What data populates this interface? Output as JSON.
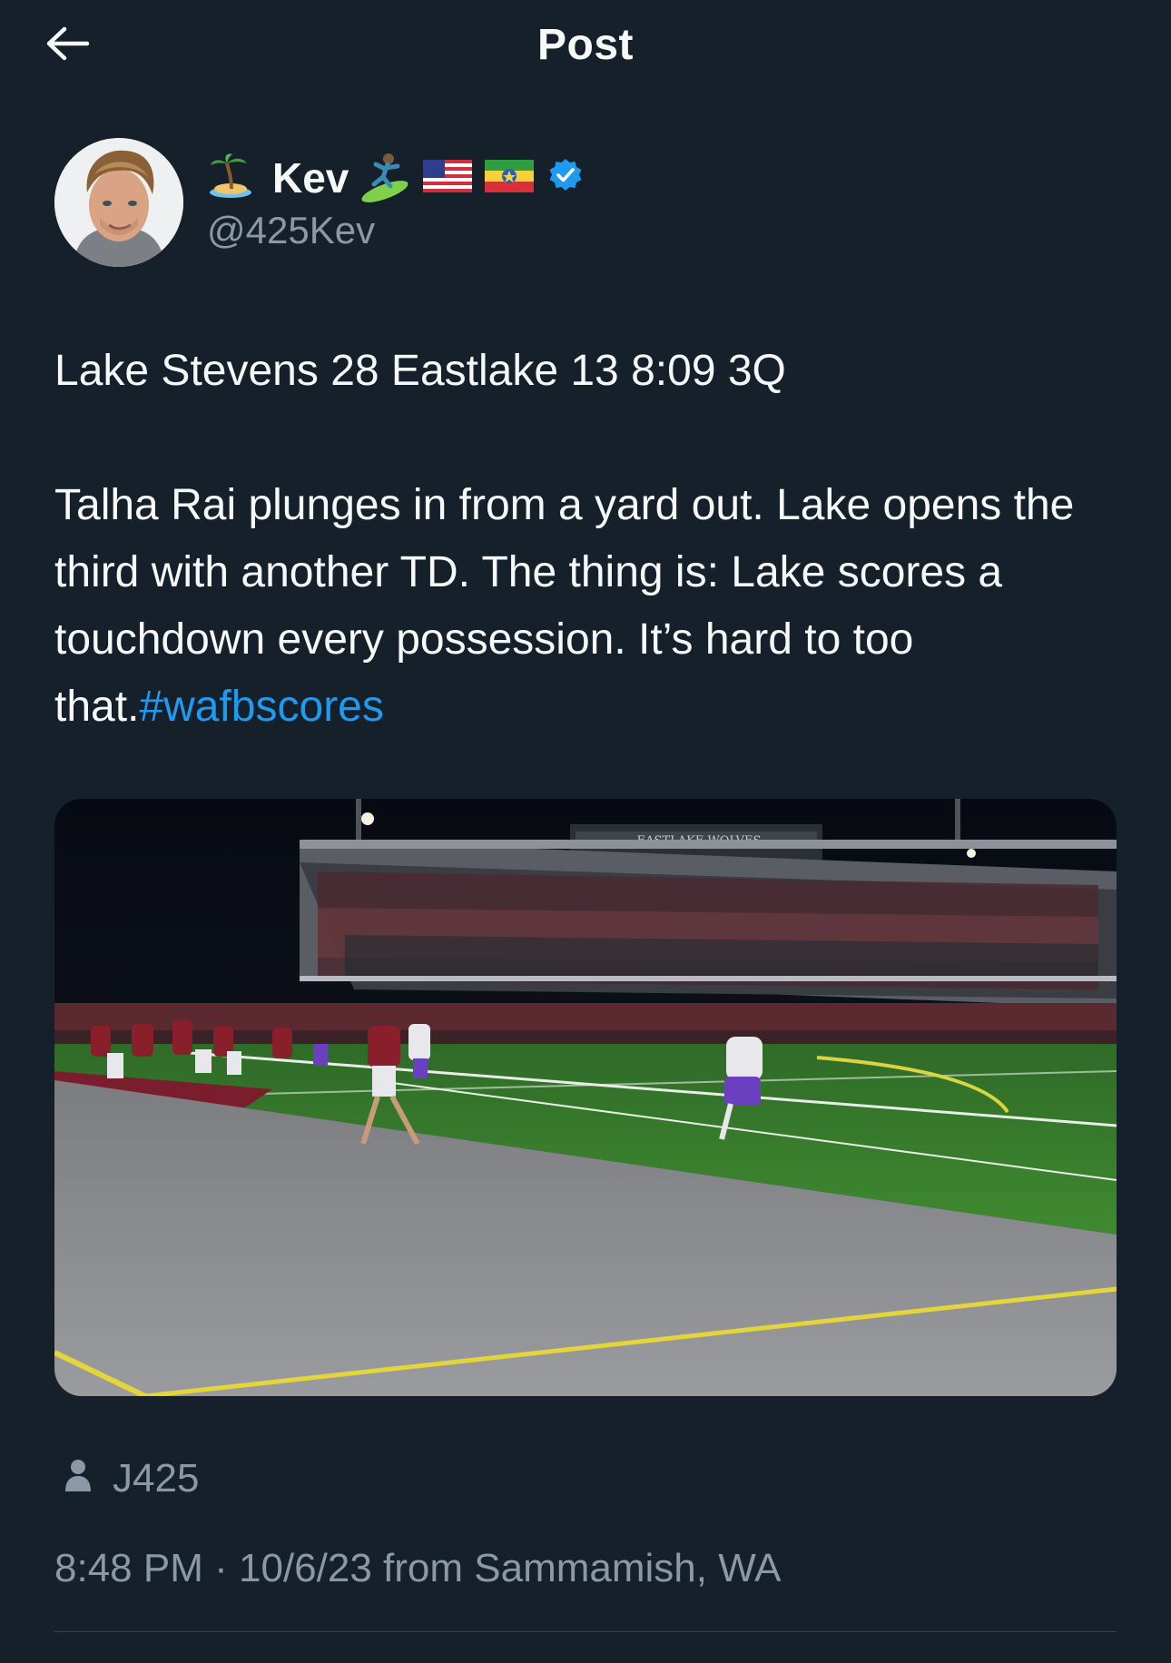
{
  "header": {
    "title": "Post",
    "back_icon": "arrow-left-icon"
  },
  "author": {
    "display_name": "Kev",
    "handle": "@425Kev",
    "avatar": "profile-photo",
    "emojis": [
      "desert-island-emoji",
      "surfer-emoji",
      "us-flag-emoji",
      "ethiopia-flag-emoji"
    ],
    "verified_icon": "verified-badge-icon",
    "verified_color": "#1d9bf0"
  },
  "tweet": {
    "line1": "Lake Stevens 28 Eastlake 13 8:09 3Q",
    "body": "Talha Rai plunges in from a yard out. Lake opens the third with another TD. The thing is: Lake scores a touchdown every possession. It’s hard to too that.",
    "hashtag": "#wafbscores",
    "hashtag_color": "#1d9bf0"
  },
  "media": {
    "image": "football-game-photo",
    "stadium_sign": "EASTLAKE WOLVES"
  },
  "attribution": {
    "icon": "person-icon",
    "label": "J425"
  },
  "meta": {
    "time": "8:48 PM",
    "separator": "·",
    "date": "10/6/23",
    "source": "from Sammamish, WA"
  },
  "colors": {
    "background": "#15202b",
    "text": "#f7f9f9",
    "secondary": "#8b98a5",
    "divider": "#38444d"
  }
}
